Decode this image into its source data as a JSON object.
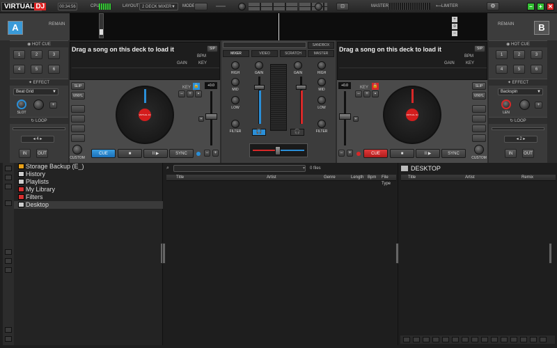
{
  "topbar": {
    "logo_text": "VIRTUAL",
    "logo_dj": "DJ",
    "clock": "00:34:56",
    "cpu_label": "CPU",
    "layout_label": "LAYOUT",
    "layout_value": "2 DECK MIXER",
    "mode_label": "MODE",
    "master_label": "MASTER",
    "limiter_label": "LIMITER"
  },
  "decks": {
    "a": {
      "badge": "A",
      "strip_label": "REMAIN",
      "song": "Drag a song on this deck to load it",
      "bpm_label": "BPM",
      "gain_label": "GAIN",
      "key_label": "KEY",
      "pitch_value": "+0.0",
      "cue": "CUE",
      "play": "■",
      "pause": "II ▶",
      "sync": "SYNC",
      "custom": "CUSTOM",
      "slip": "SLIP",
      "vinyl": "VINYL",
      "key_btn": "KEY",
      "platter_label": "VIRTUAL DJ"
    },
    "b": {
      "badge": "B",
      "strip_label": "REMAIN",
      "song": "Drag a song on this deck to load it",
      "bpm_label": "BPM",
      "gain_label": "GAIN",
      "key_label": "KEY",
      "pitch_value": "+0.0",
      "cue": "CUE",
      "play": "■",
      "pause": "II ▶",
      "sync": "SYNC",
      "custom": "CUSTOM",
      "slip": "SLIP",
      "vinyl": "VINYL",
      "key_btn": "KEY",
      "platter_label": "VIRTUAL DJ"
    }
  },
  "left_panel": {
    "hotcue_label": "HOT CUE",
    "hotcues": [
      "1",
      "2",
      "3",
      "4",
      "5",
      "6"
    ],
    "effect_label": "EFFECT",
    "effect_value": "Beat Grid",
    "slot_label": "SLOT",
    "loop_label": "LOOP",
    "loop_value": "4",
    "in": "IN",
    "out": "OUT"
  },
  "right_panel": {
    "hotcue_label": "HOT CUE",
    "hotcues": [
      "1",
      "2",
      "3",
      "4",
      "5",
      "6"
    ],
    "effect_label": "EFFECT",
    "effect_value": "Backspin",
    "len_label": "LEN",
    "loop_label": "LOOP",
    "loop_value": "2",
    "in": "IN",
    "out": "OUT"
  },
  "mixer": {
    "tabs": [
      "MIXER",
      "VIDEO",
      "SCRATCH",
      "MASTER"
    ],
    "sandbox": "SANDBOX",
    "knobs": [
      "HIGH",
      "GAIN",
      "HIGH",
      "MID",
      "MID",
      "LOW",
      "LOW",
      "FILTER",
      "FILTER"
    ]
  },
  "browser": {
    "tree": [
      {
        "label": "Storage Backup (E_)",
        "color": "#e8a018"
      },
      {
        "label": "History",
        "color": "#cccccc"
      },
      {
        "label": "Playlists",
        "color": "#cccccc"
      },
      {
        "label": "My Library",
        "color": "#d83030"
      },
      {
        "label": "Filters",
        "color": "#d83030"
      },
      {
        "label": "Desktop",
        "color": "#cccccc"
      }
    ],
    "search_placeholder": "",
    "files_count": "0 files",
    "columns": [
      "Title",
      "Artist",
      "Genre",
      "Length",
      "Bpm",
      "File Type"
    ],
    "side_title": "DESKTOP",
    "side_columns": [
      "Title",
      "Artist",
      "Remix"
    ]
  },
  "colors": {
    "deck_a": "#2a8fd8",
    "deck_b": "#d82828",
    "accent_green": "#35c035",
    "close_red": "#d82828"
  }
}
